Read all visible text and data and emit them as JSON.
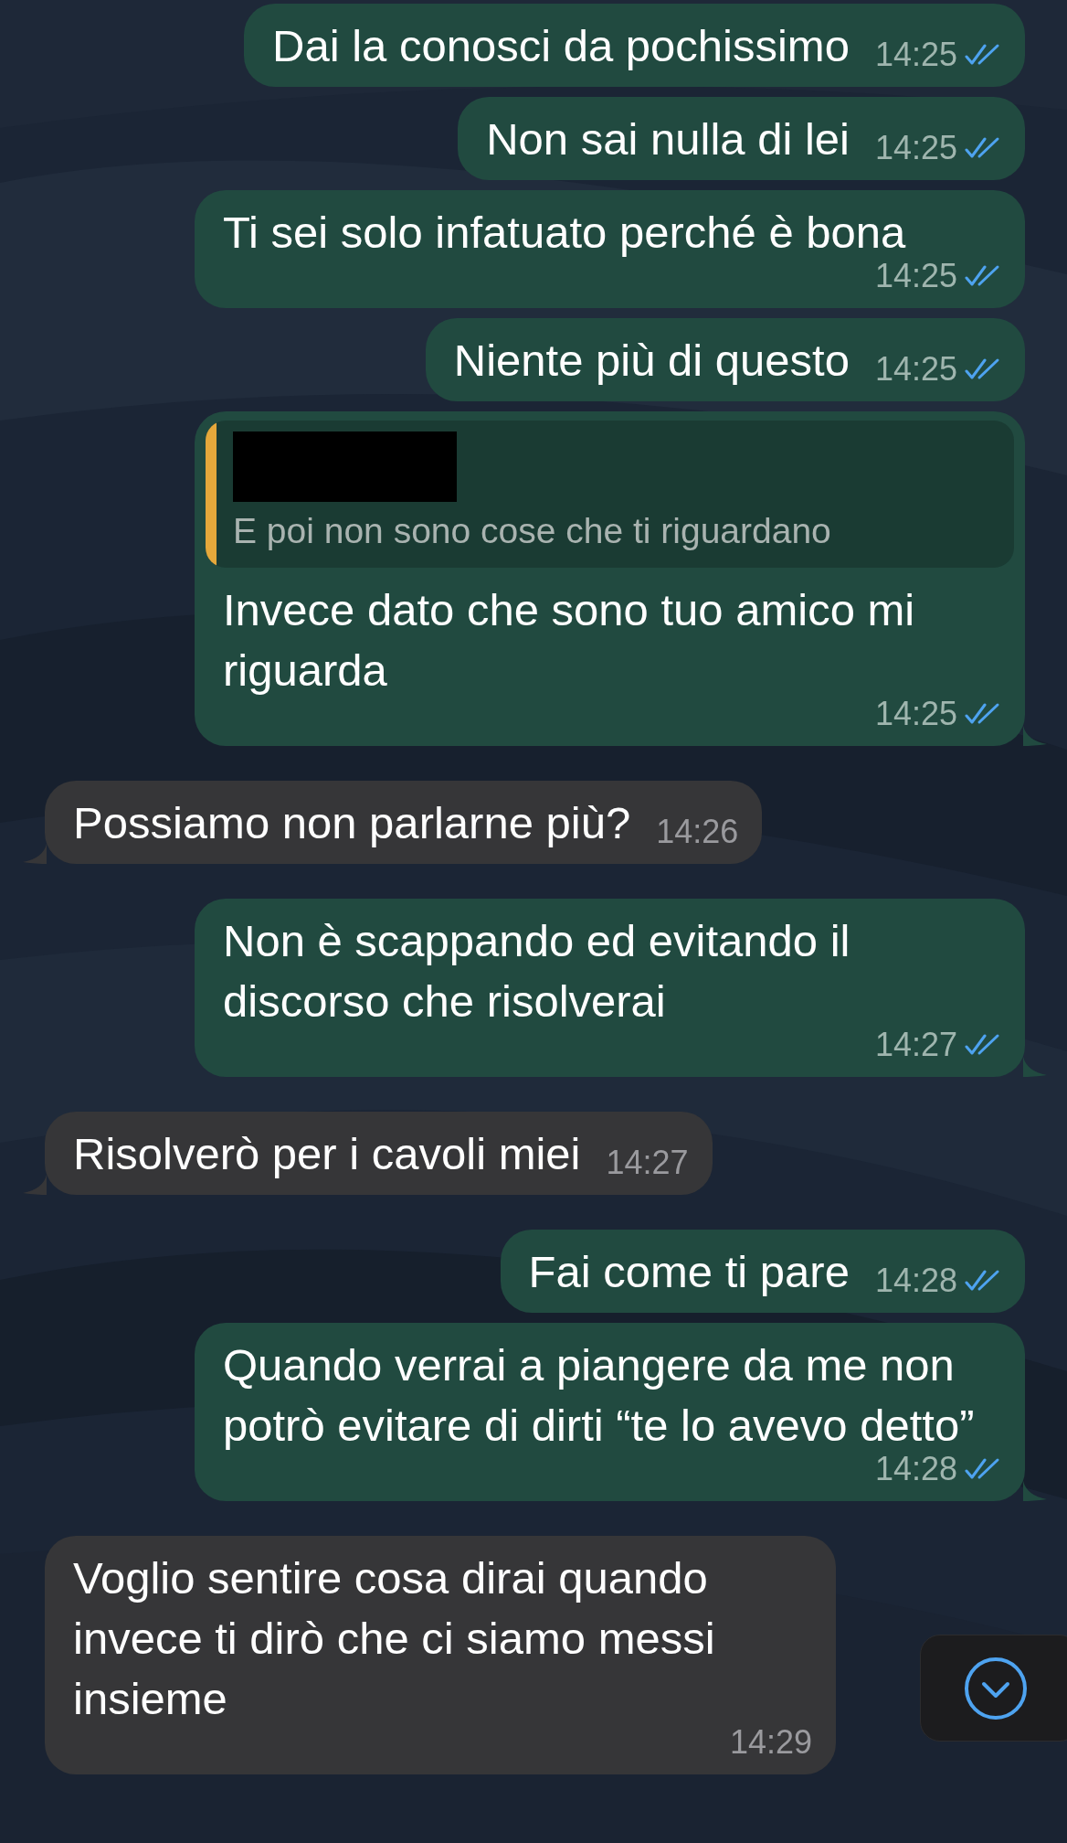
{
  "messages": [
    {
      "kind": "outgoing",
      "text": "Dai la conosci da pochissimo",
      "time": "14:25",
      "read": true,
      "tail": false
    },
    {
      "kind": "outgoing",
      "text": "Non sai nulla di lei",
      "time": "14:25",
      "read": true,
      "tail": false
    },
    {
      "kind": "outgoing",
      "text": "Ti sei solo infatuato perché è bona",
      "time": "14:25",
      "read": true,
      "tail": false
    },
    {
      "kind": "outgoing",
      "text": "Niente più di questo",
      "time": "14:25",
      "read": true,
      "tail": false
    },
    {
      "kind": "outgoing",
      "quote": {
        "author_redacted": true,
        "text": "E poi non sono cose che ti riguardano"
      },
      "text": "Invece dato che sono tuo amico mi riguarda",
      "time": "14:25",
      "read": true,
      "tail": true
    },
    {
      "kind": "incoming",
      "text": "Possiamo non parlarne più?",
      "time": "14:26",
      "tail": true
    },
    {
      "kind": "outgoing",
      "text": "Non è scappando ed evitando il discorso che risolverai",
      "time": "14:27",
      "read": true,
      "tail": true
    },
    {
      "kind": "incoming",
      "text": "Risolverò per i cavoli miei",
      "time": "14:27",
      "tail": true
    },
    {
      "kind": "outgoing",
      "text": "Fai come ti pare",
      "time": "14:28",
      "read": true,
      "tail": false
    },
    {
      "kind": "outgoing",
      "text": "Quando verrai a piangere da me non potrò evitare di dirti “te lo avevo detto”",
      "time": "14:28",
      "read": true,
      "tail": true
    },
    {
      "kind": "incoming",
      "text": "Voglio sentire cosa dirai quando invece ti dirò che ci siamo messi insieme",
      "time": "14:29",
      "tail": false
    }
  ],
  "scroll_down_button": {
    "visible": true
  }
}
